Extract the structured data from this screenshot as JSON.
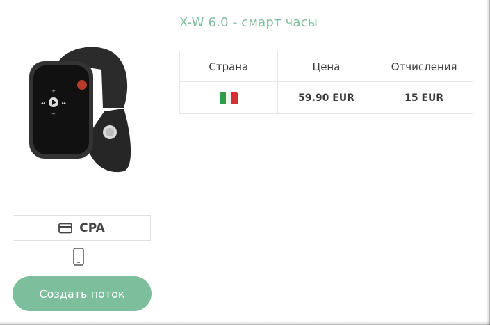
{
  "product": {
    "title": "X-W 6.0 - смарт часы",
    "image_icon": "smartwatch-image"
  },
  "table": {
    "headers": [
      "Страна",
      "Цена",
      "Отчисления"
    ],
    "rows": [
      {
        "country_flag": "italy-flag-icon",
        "price": "59.90 EUR",
        "commission": "15 EUR"
      }
    ]
  },
  "model": {
    "label": "CPA",
    "icon": "credit-card-icon"
  },
  "device_icon": "mobile-phone-icon",
  "actions": {
    "create_label": "Создать поток"
  },
  "colors": {
    "accent": "#7dbf9c",
    "title": "#7fbf9e",
    "border": "#e6e6e6"
  }
}
